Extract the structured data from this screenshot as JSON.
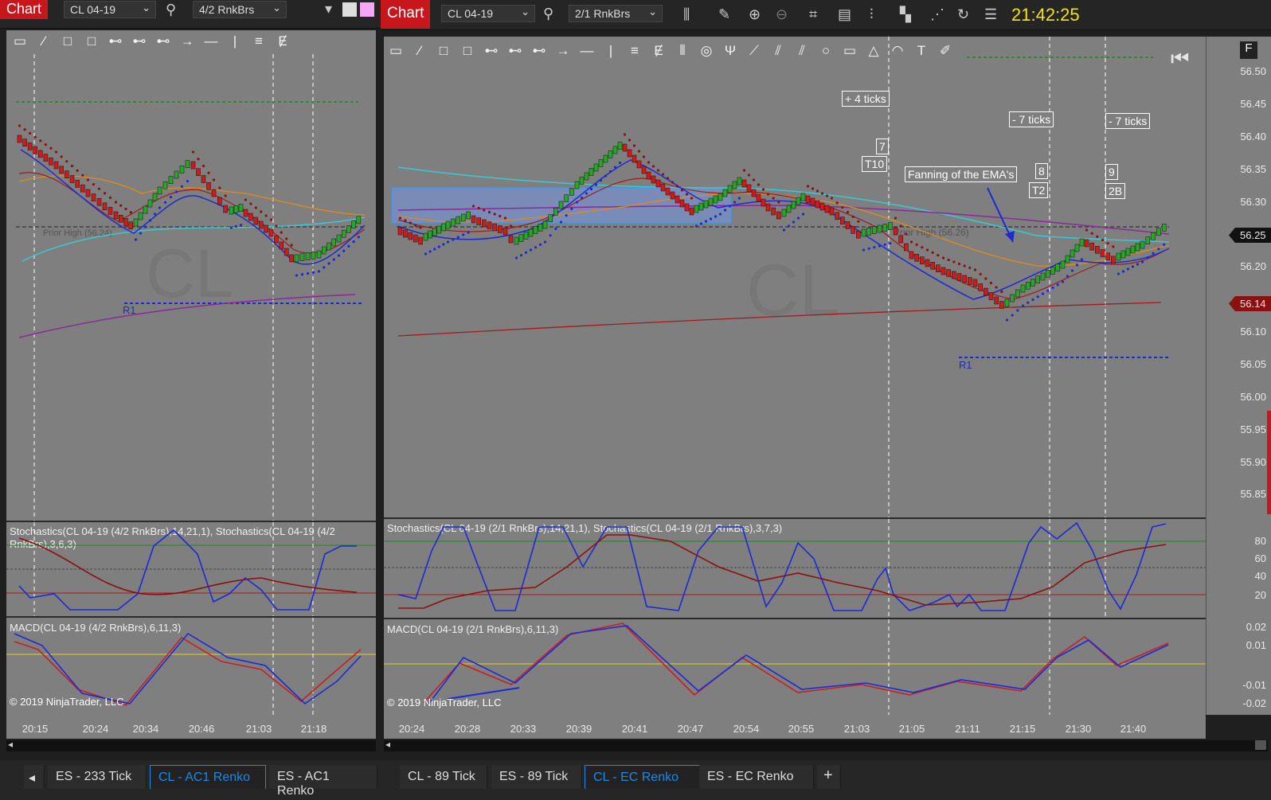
{
  "left": {
    "badge": "Chart",
    "instrument": "CL 04-19",
    "bartype": "4/2 RnkBrs",
    "watermark": "CL",
    "prior_high": "Prior High (56.24)",
    "r1": "R1",
    "stoch_title": "Stochastics(CL 04-19 (4/2 RnkBrs),14,21,1), Stochastics(CL 04-19 (4/2 RnkBrs),3,6,3)",
    "macd_title": "MACD(CL 04-19 (4/2 RnkBrs),6,11,3)",
    "copyright": "© 2019 NinjaTrader, LLC",
    "x_ticks": [
      "20:15",
      "20:24",
      "20:34",
      "20:46",
      "21:03",
      "21:18"
    ],
    "tabs": [
      "ES - 233 Tick",
      "CL - AC1 Renko",
      "ES - AC1 Renko"
    ],
    "active_tab": 1
  },
  "right": {
    "badge": "Chart",
    "instrument": "CL 04-19",
    "bartype": "2/1 RnkBrs",
    "clock": "21:42:25",
    "watermark": "CL",
    "prior_high": "Prior High (56.26)",
    "r1": "R1",
    "stoch_title": "Stochastics(CL 04-19 (2/1 RnkBrs),14,21,1), Stochastics(CL 04-19 (2/1 RnkBrs),3,7,3)",
    "macd_title": "MACD(CL 04-19 (2/1 RnkBrs),6,11,3)",
    "copyright": "© 2019 NinjaTrader, LLC",
    "price_axis": [
      "56.50",
      "56.45",
      "56.40",
      "56.35",
      "56.30",
      "56.25",
      "56.20",
      "56.15",
      "56.10",
      "56.05",
      "56.00",
      "55.95",
      "55.90",
      "55.85"
    ],
    "last_price": "56.25",
    "r1_price": "56.14",
    "stoch_axis": [
      "80",
      "60",
      "40",
      "20"
    ],
    "macd_axis": [
      "0.02",
      "0.01",
      "-0.01",
      "-0.02"
    ],
    "x_ticks": [
      "20:24",
      "20:28",
      "20:33",
      "20:39",
      "20:41",
      "20:47",
      "20:54",
      "20:55",
      "21:03",
      "21:05",
      "21:11",
      "21:15",
      "21:30",
      "21:40"
    ],
    "annotations": {
      "plus4": "+ 4 ticks",
      "minus7a": "- 7 ticks",
      "minus7b": "- 7 ticks",
      "n7": "7",
      "t10": "T10",
      "fanning": "Fanning of the EMA's",
      "n8": "8",
      "t2": "T2",
      "n9": "9",
      "b2": "2B"
    },
    "corner": "F",
    "tabs": [
      "CL - 89 Tick",
      "ES - 89 Tick",
      "CL - EC Renko",
      "ES - EC Renko"
    ],
    "add_tab": "+",
    "active_tab": 2
  },
  "colors": {
    "up_bar": "#2aa52a",
    "down_bar": "#d11a1a",
    "ema_blue": "#1a2bd6",
    "ema_orange": "#e08a1a",
    "ema_cyan": "#39c9d6",
    "ema_purple": "#8a2a9a",
    "ema_red": "#a01c1c",
    "stoch_fast": "#1a2bd6",
    "stoch_slow": "#8b1010",
    "clock": "#f1e40f",
    "tab_active": "#1e88e5"
  }
}
